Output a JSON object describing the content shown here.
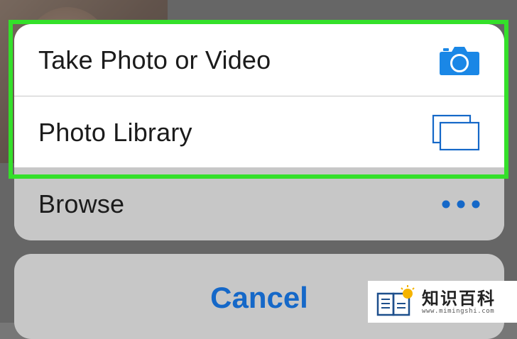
{
  "action_sheet": {
    "items": [
      {
        "label": "Take Photo or Video",
        "icon": "camera-icon"
      },
      {
        "label": "Photo Library",
        "icon": "photo-library-icon"
      },
      {
        "label": "Browse",
        "icon": "more-icon"
      }
    ]
  },
  "cancel": {
    "label": "Cancel"
  },
  "watermark": {
    "title": "知识百科",
    "url": "www.mimingshi.com"
  },
  "colors": {
    "accent": "#1568C8",
    "highlight": "#34E02A",
    "sheet_bg": "#C7C7C7"
  }
}
